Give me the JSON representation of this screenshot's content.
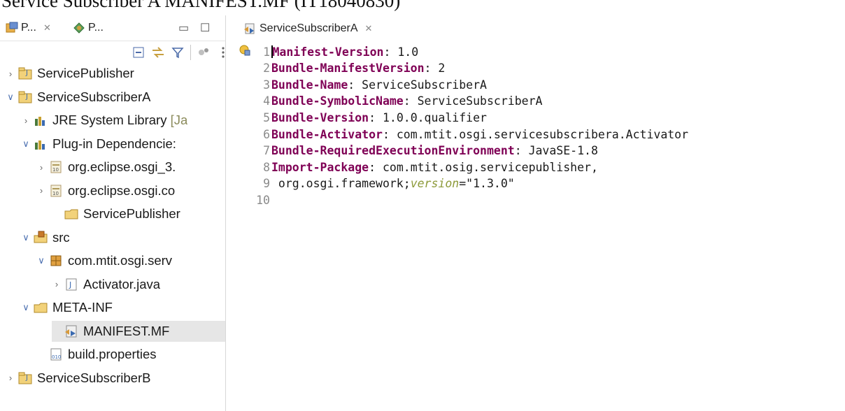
{
  "doc_title": "Service Subscriber A MANIFEST.MF (IT18040830)",
  "left_panel": {
    "tab1_label": "P...",
    "tab2_label": "P...",
    "tree": [
      {
        "label": "ServicePublisher",
        "suffix": "",
        "chevron": "closed",
        "icon": "project-icon",
        "selected": false
      },
      {
        "label": "ServiceSubscriberA",
        "suffix": "",
        "chevron": "open",
        "icon": "project-icon",
        "selected": false
      },
      {
        "label": "JRE System Library ",
        "suffix": "[Ja",
        "chevron": "closed",
        "icon": "library-icon",
        "selected": false
      },
      {
        "label": "Plug-in Dependencie:",
        "suffix": "",
        "chevron": "open",
        "icon": "library-icon",
        "selected": false
      },
      {
        "label": "org.eclipse.osgi_3.",
        "suffix": "",
        "chevron": "closed",
        "icon": "jar-icon",
        "selected": false
      },
      {
        "label": "org.eclipse.osgi.co",
        "suffix": "",
        "chevron": "closed",
        "icon": "jar-icon",
        "selected": false
      },
      {
        "label": "ServicePublisher",
        "suffix": "",
        "chevron": "none",
        "icon": "folder-icon",
        "selected": false
      },
      {
        "label": "src",
        "suffix": "",
        "chevron": "open",
        "icon": "source-folder-icon",
        "selected": false
      },
      {
        "label": "com.mtit.osgi.serv",
        "suffix": "",
        "chevron": "open",
        "icon": "package-icon",
        "selected": false
      },
      {
        "label": "Activator.java",
        "suffix": "",
        "chevron": "closed",
        "icon": "java-file-icon",
        "selected": false
      },
      {
        "label": "META-INF",
        "suffix": "",
        "chevron": "open",
        "icon": "folder-icon",
        "selected": false
      },
      {
        "label": "MANIFEST.MF",
        "suffix": "",
        "chevron": "none",
        "icon": "manifest-icon",
        "selected": true
      },
      {
        "label": "build.properties",
        "suffix": "",
        "chevron": "none",
        "icon": "properties-icon",
        "selected": false
      },
      {
        "label": "ServiceSubscriberB",
        "suffix": "",
        "chevron": "closed",
        "icon": "project-icon",
        "selected": false
      }
    ]
  },
  "editor": {
    "tab_label": "ServiceSubscriberA",
    "lines": [
      {
        "num": "1",
        "key": "Manifest-Version",
        "sep": ": ",
        "value": "1.0"
      },
      {
        "num": "2",
        "key": "Bundle-ManifestVersion",
        "sep": ": ",
        "value": "2"
      },
      {
        "num": "3",
        "key": "Bundle-Name",
        "sep": ": ",
        "value": "ServiceSubscriberA"
      },
      {
        "num": "4",
        "key": "Bundle-SymbolicName",
        "sep": ": ",
        "value": "ServiceSubscriberA"
      },
      {
        "num": "5",
        "key": "Bundle-Version",
        "sep": ": ",
        "value": "1.0.0.qualifier"
      },
      {
        "num": "6",
        "key": "Bundle-Activator",
        "sep": ": ",
        "value": "com.mtit.osgi.servicesubscribera.Activator"
      },
      {
        "num": "7",
        "key": "Bundle-RequiredExecutionEnvironment",
        "sep": ": ",
        "value": "JavaSE-1.8"
      },
      {
        "num": "8",
        "key": "Import-Package",
        "sep": ": ",
        "value": "com.mtit.osig.servicepublisher,"
      },
      {
        "num": "9",
        "key": "",
        "sep": "",
        "value": " org.osgi.framework;",
        "attr": "version",
        "attr_value": "=\"1.3.0\""
      },
      {
        "num": "10",
        "key": "",
        "sep": "",
        "value": ""
      }
    ]
  }
}
